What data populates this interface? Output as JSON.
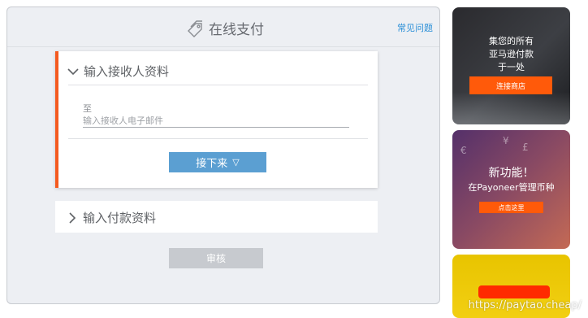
{
  "header": {
    "title": "在线支付",
    "faq_link": "常见问题",
    "icon": "payment-tag-icon"
  },
  "recipient_section": {
    "title": "输入接收人资料",
    "to_label": "至",
    "email_placeholder": "输入接收人电子邮件",
    "email_value": "",
    "next_button": "接下来",
    "next_icon": "▽"
  },
  "payment_section": {
    "title": "输入付款资料"
  },
  "review_button": "审核",
  "ads": {
    "ad1": {
      "line1": "集您的所有",
      "line2": "亚马逊付款",
      "line3": "于一处",
      "cta": "连接商店"
    },
    "ad2": {
      "line1": "新功能！",
      "line2": "在Payoneer管理币种",
      "cta": "点击这里"
    }
  },
  "watermark": "https://paytao.cheap/",
  "colors": {
    "accent_orange": "#f45a1f",
    "button_blue": "#5b9fd2",
    "link_blue": "#2a8fd7",
    "disabled_gray": "#c7cacf"
  }
}
